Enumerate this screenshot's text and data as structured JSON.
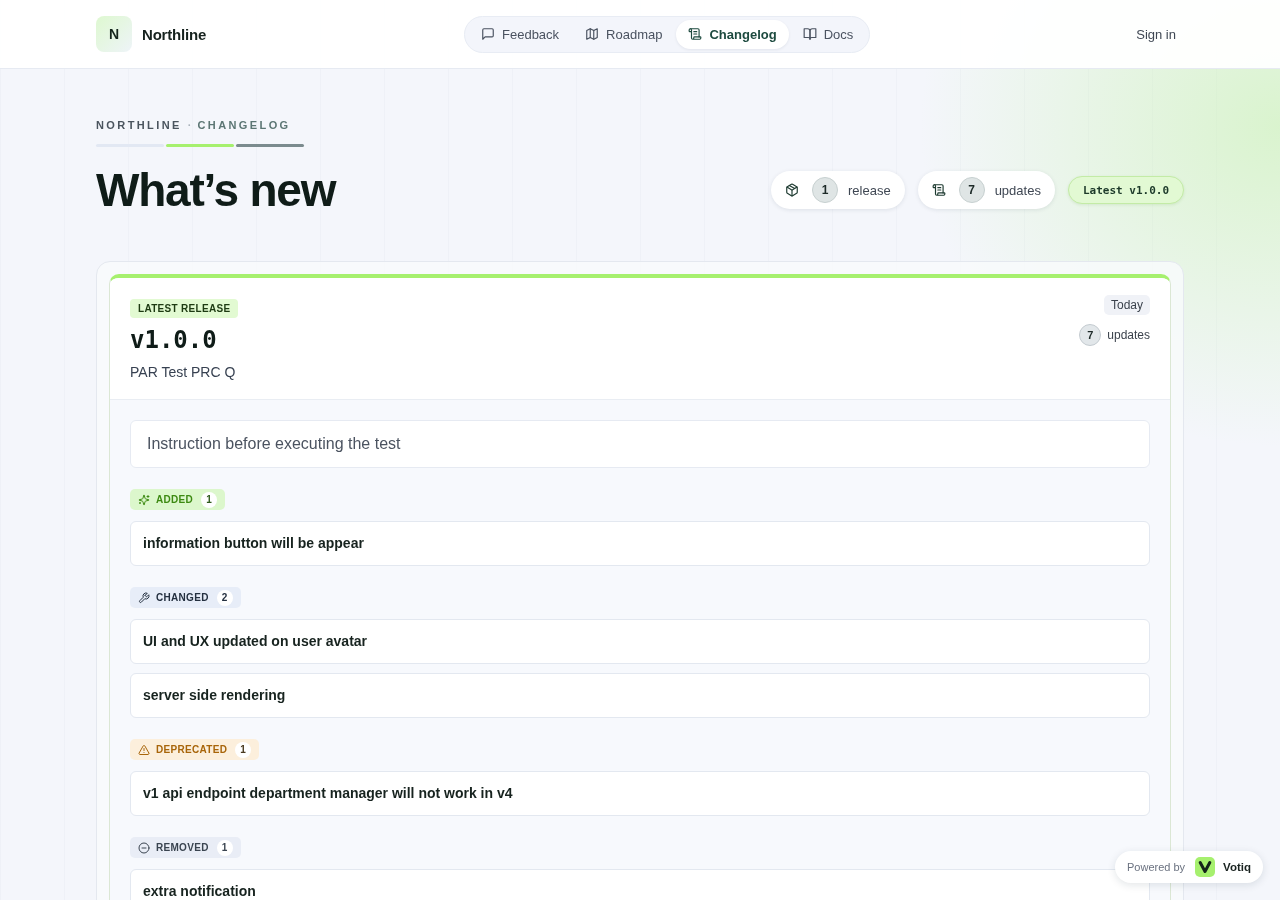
{
  "header": {
    "brand": {
      "initial": "N",
      "name": "Northline"
    },
    "nav": [
      {
        "label": "Feedback",
        "selected": false
      },
      {
        "label": "Roadmap",
        "selected": false
      },
      {
        "label": "Changelog",
        "selected": true
      },
      {
        "label": "Docs",
        "selected": false
      }
    ],
    "sign_in": "Sign in"
  },
  "hero": {
    "breadcrumb": {
      "site": "NORTHLINE",
      "separator": "·",
      "page": "CHANGELOG"
    },
    "title": "What’s new",
    "stats": [
      {
        "count": "1",
        "label": "release"
      },
      {
        "count": "7",
        "label": "updates"
      }
    ],
    "latest": "Latest v1.0.0"
  },
  "releases": [
    {
      "badge": "LATEST RELEASE",
      "version": "v1.0.0",
      "name": "PAR Test PRC Q",
      "date": "Today",
      "update_count": "7",
      "update_label": "updates",
      "instruction": "Instruction before executing the test",
      "sections": [
        {
          "kind": "added",
          "label": "ADDED",
          "count": "1",
          "items": [
            "information button will be appear"
          ]
        },
        {
          "kind": "changed",
          "label": "CHANGED",
          "count": "2",
          "items": [
            "UI and UX updated on user avatar",
            "server side rendering"
          ]
        },
        {
          "kind": "deprecated",
          "label": "DEPRECATED",
          "count": "1",
          "items": [
            "v1 api endpoint department manager will not work in v4"
          ]
        },
        {
          "kind": "removed",
          "label": "REMOVED",
          "count": "1",
          "items": [
            "extra notification"
          ]
        }
      ]
    }
  ],
  "powered_by": {
    "prefix": "Powered by",
    "brand": "Votiq"
  }
}
